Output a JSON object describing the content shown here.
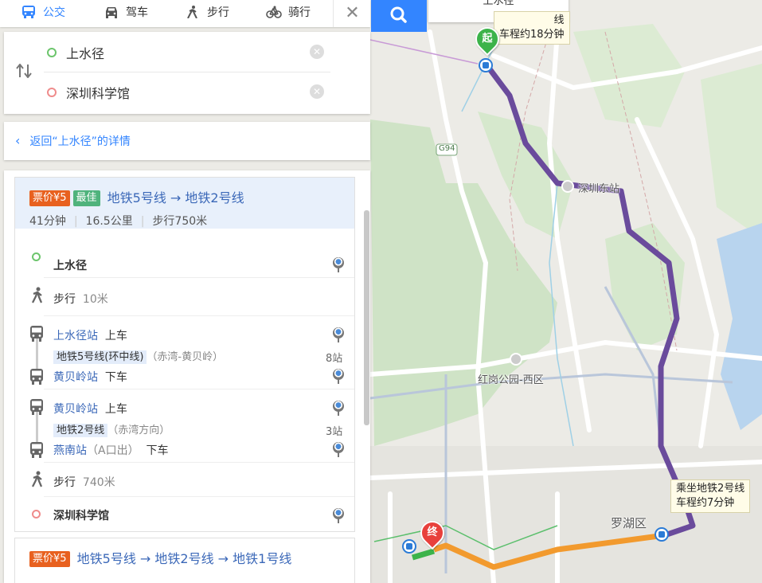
{
  "modes": [
    {
      "label": "公交",
      "icon": "bus-icon",
      "active": true
    },
    {
      "label": "驾车",
      "icon": "car-icon",
      "active": false
    },
    {
      "label": "步行",
      "icon": "walk-icon",
      "active": false
    },
    {
      "label": "骑行",
      "icon": "bike-icon",
      "active": false
    }
  ],
  "close_label": "✕",
  "route": {
    "from": "上水径",
    "to": "深圳科学馆"
  },
  "back_text": "返回“上水径”的详情",
  "scheme1": {
    "price": "票价¥5",
    "best": "最佳",
    "title": "地铁5号线 → 地铁2号线",
    "time": "41分钟",
    "distance": "16.5公里",
    "walk": "步行750米",
    "steps": {
      "origin": "上水径",
      "walk1_label": "步行",
      "walk1_dist": "10米",
      "board1_station": "上水径站",
      "board1_action": "上车",
      "line1_name": "地铁5号线(环中线)",
      "line1_dir": "（赤湾-黄贝岭）",
      "line1_stops": "8站",
      "alight1_station": "黄贝岭站",
      "alight1_action": "下车",
      "board2_station": "黄贝岭站",
      "board2_action": "上车",
      "line2_name": "地铁2号线",
      "line2_dir": "（赤湾方向）",
      "line2_stops": "3站",
      "alight2_station": "燕南站",
      "alight2_exit": "（A口出）",
      "alight2_action": "下车",
      "walk2_label": "步行",
      "walk2_dist": "740米",
      "destination": "深圳科学馆"
    }
  },
  "scheme2": {
    "price": "票价¥5",
    "title": "地铁5号线 → 地铁2号线 → 地铁1号线"
  },
  "map": {
    "top_box_text": "上水径",
    "tip_start_line1": "线",
    "tip_start_line2": "车程约18分钟",
    "tip_end_line1": "乘坐地铁2号线",
    "tip_end_line2": "车程约7分钟",
    "label_station": "深圳东站",
    "label_park": "红岗公园-西区",
    "label_district": "罗湖区",
    "road_shield": "G94",
    "start_marker": "起",
    "end_marker": "终",
    "colors": {
      "line5": "#6a4b9c",
      "line2": "#f29a2e",
      "walk": "#3cb34a",
      "accent": "#3385ff"
    }
  }
}
